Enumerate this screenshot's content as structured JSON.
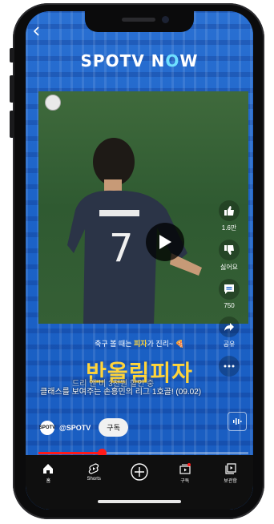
{
  "header": {
    "logo_main": "SPOTV N",
    "logo_accent": "O",
    "logo_end": "W"
  },
  "actions": {
    "like_count": "1.6만",
    "dislike_label": "싫어요",
    "comment_count": "750",
    "share_label": "공유"
  },
  "promo": {
    "tagline_prefix": "축구 볼 때는 ",
    "tagline_bold": "피자",
    "tagline_suffix": "가 진리~",
    "brand": "반올림피자",
    "sub_text": "드리 앤 비 3천원 할인 중"
  },
  "video": {
    "caption": "클래스를 보여주는 손흥민의 리그 1호골! (09.02)",
    "progress_fraction": 0.3
  },
  "channel": {
    "avatar_text": "SPOTV",
    "name": "@SPOTV",
    "subscribe_label": "구독"
  },
  "nav": {
    "items": [
      {
        "label": "홈"
      },
      {
        "label": "Shorts"
      },
      {
        "label": ""
      },
      {
        "label": "구독"
      },
      {
        "label": "보관함"
      }
    ]
  },
  "colors": {
    "brand_blue": "#1c63c8",
    "promo_yellow": "#ffd43a",
    "progress_red": "#ff1a1a"
  }
}
